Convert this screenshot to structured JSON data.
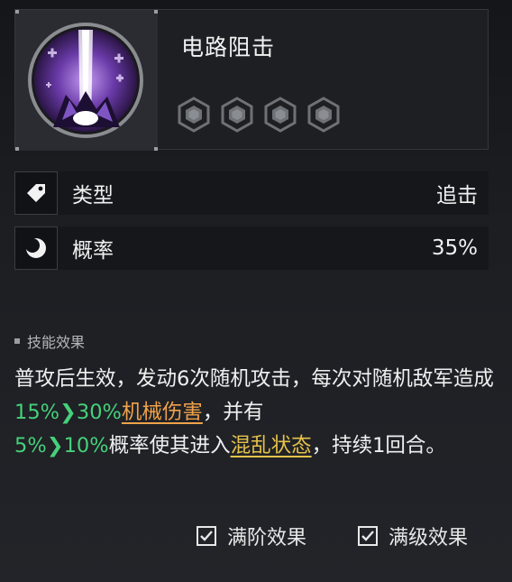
{
  "skill": {
    "name": "电路阻击",
    "icon": "skill-lightning-icon",
    "star_count": 4,
    "star_icon": "hexagon-star-icon"
  },
  "attributes": [
    {
      "icon": "tag-icon",
      "label": "类型",
      "value": "追击"
    },
    {
      "icon": "moon-icon",
      "label": "概率",
      "value": "35%"
    }
  ],
  "effect": {
    "title": "技能效果",
    "segments": {
      "t1": "普攻后生效，发动6次随机攻击，每次对随机敌军造成",
      "d1_from": "15%",
      "d1_to": "30%",
      "dmg": "机械伤害",
      "t2": "，并有",
      "p_from": "5%",
      "p_to": "10%",
      "t3": "概率使其进入",
      "status": "混乱状态",
      "t4": "，持续1回合。"
    },
    "colors": {
      "highlight": "#46d07a",
      "damage_type": "#f0a24a",
      "status": "#e6c24a"
    }
  },
  "toggles": [
    {
      "label": "满阶效果",
      "checked": true
    },
    {
      "label": "满级效果",
      "checked": true
    }
  ]
}
